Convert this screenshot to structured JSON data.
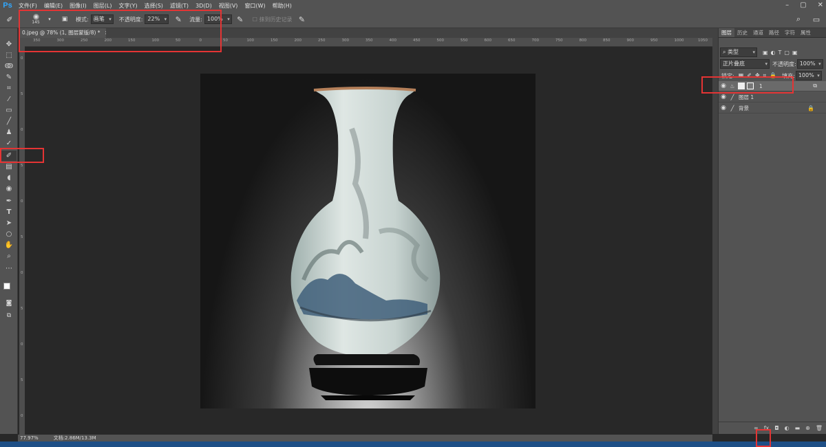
{
  "app": {
    "logo": "Ps"
  },
  "menu": [
    "文件(F)",
    "编辑(E)",
    "图像(I)",
    "图层(L)",
    "文字(Y)",
    "选择(S)",
    "滤镜(T)",
    "3D(D)",
    "视图(V)",
    "窗口(W)",
    "帮助(H)"
  ],
  "window_controls": [
    "–",
    "▢",
    "✕"
  ],
  "options": {
    "brush_size": "145",
    "mode_label": "模式:",
    "mode_value": "画笔",
    "opacity_label": "不透明度:",
    "opacity_value": "22%",
    "flow_label": "流量:",
    "flow_value": "100%",
    "erase_history_label": "抹到历史记录"
  },
  "document": {
    "tab_label": "0.jpeg @ 78% (1, 图层蒙版/8) *",
    "close": "×"
  },
  "ruler_h_ticks": [
    "350",
    "300",
    "250",
    "200",
    "150",
    "100",
    "50",
    "0",
    "50",
    "100",
    "150",
    "200",
    "250",
    "300",
    "350",
    "400",
    "450",
    "500",
    "550",
    "600",
    "650",
    "700",
    "750",
    "800",
    "850",
    "900",
    "950",
    "1000",
    "1050",
    "1100",
    "1150",
    "1200"
  ],
  "ruler_v_ticks": [
    "0",
    "5",
    "0",
    "5",
    "0",
    "5",
    "0",
    "5",
    "0",
    "5",
    "0"
  ],
  "panel": {
    "tabs": [
      "图层",
      "历史",
      "通道",
      "路径",
      "字符",
      "属性"
    ],
    "filter_label": "类型",
    "blend_mode": "正片叠底",
    "opacity_label": "不透明度:",
    "opacity_value": "100%",
    "lock_label": "锁定:",
    "fill_label": "填充:",
    "fill_value": "100%",
    "layers": [
      {
        "name": "1",
        "selected": true
      },
      {
        "name": "图层 1",
        "selected": false
      },
      {
        "name": "背景",
        "selected": false,
        "locked": true
      }
    ],
    "bottom_icons": [
      "∞",
      "fx",
      "◘",
      "◐",
      "▬",
      "⊕",
      "🗑"
    ]
  },
  "status": {
    "zoom": "77.97%",
    "doc_info": "文档:2.86M/13.3M"
  },
  "colors": {
    "accent": "#31a8ff",
    "highlight_box": "#e53434"
  }
}
